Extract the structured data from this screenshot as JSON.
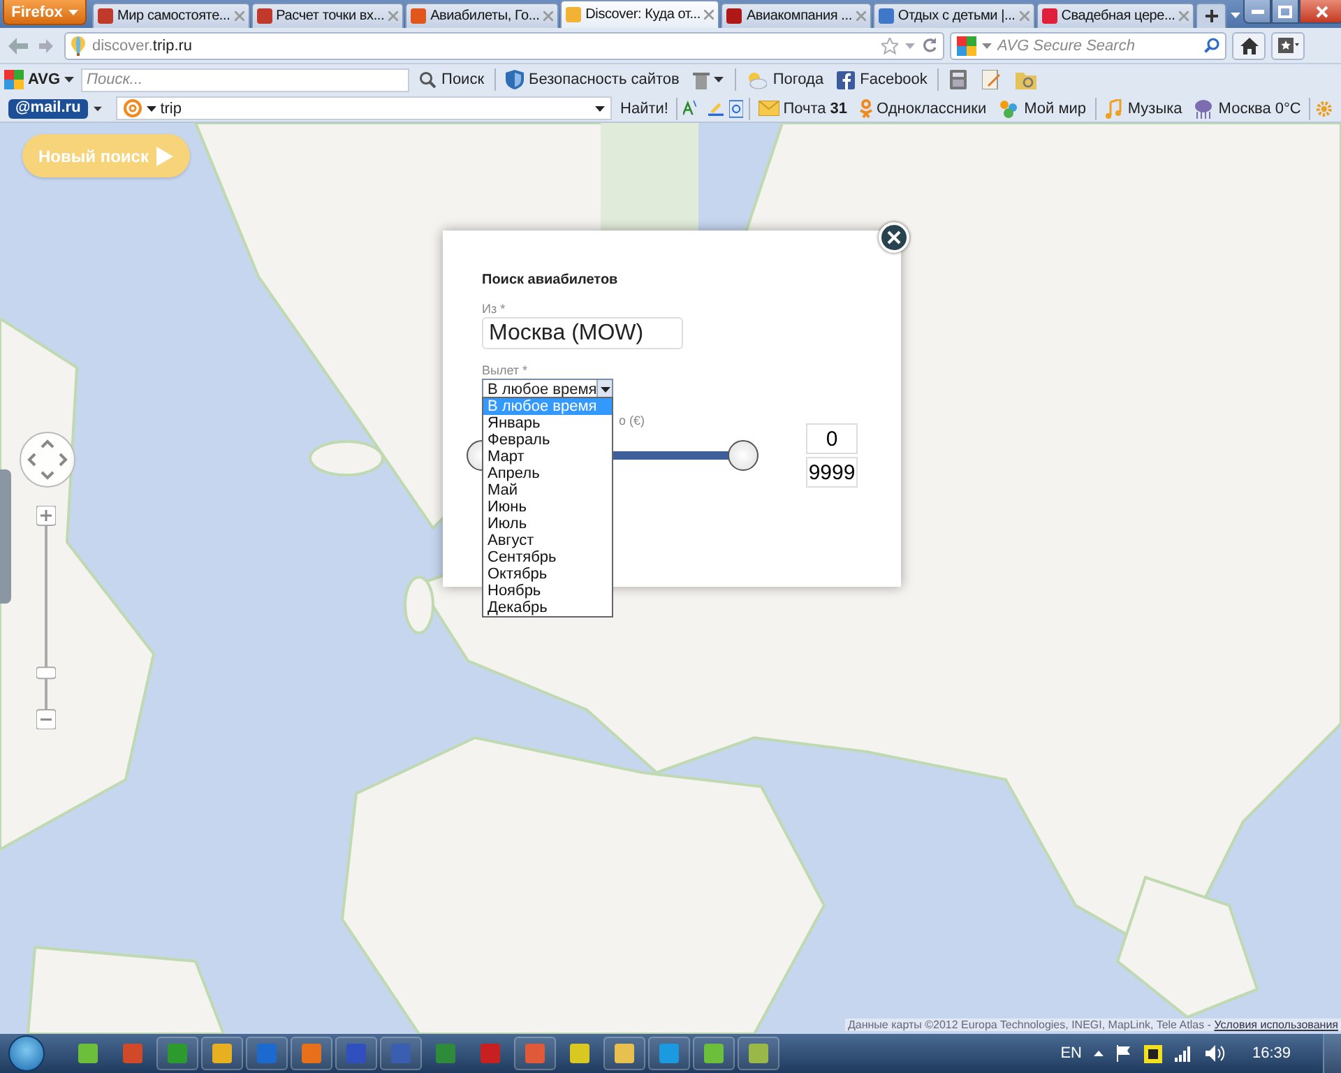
{
  "browser": {
    "menu_button": "Firefox",
    "tabs": [
      {
        "title": "Мир самостояте...",
        "selected": false,
        "color": "#c0392b"
      },
      {
        "title": "Расчет точки вх...",
        "selected": false,
        "color": "#c0392b"
      },
      {
        "title": "Авиабилеты, Го...",
        "selected": false,
        "color": "#e0561b"
      },
      {
        "title": "Discover: Куда от...",
        "selected": true,
        "color": "#f2b233"
      },
      {
        "title": "Авиакомпания ...",
        "selected": false,
        "color": "#b01818"
      },
      {
        "title": "Отдых с детьми |...",
        "selected": false,
        "color": "#3f78c8"
      },
      {
        "title": "Свадебная цере...",
        "selected": false,
        "color": "#e0203a"
      }
    ],
    "address": {
      "subdomain": "discover.",
      "domain": "trip.ru"
    },
    "search_placeholder": "AVG Secure Search"
  },
  "avg_toolbar": {
    "logo": "AVG",
    "search_placeholder": "Поиск...",
    "search_button": "Поиск",
    "items": [
      {
        "kind": "shield",
        "label": "Безопасность сайтов"
      },
      {
        "kind": "trash"
      },
      {
        "kind": "weather",
        "label": "Погода"
      },
      {
        "kind": "facebook",
        "label": "Facebook"
      },
      {
        "kind": "calculator"
      },
      {
        "kind": "notepad"
      },
      {
        "kind": "folder"
      }
    ]
  },
  "mail_toolbar": {
    "logo": "@mail.ru",
    "query": "trip",
    "find_button": "Найти!",
    "items": [
      {
        "kind": "mail",
        "label": "Почта",
        "badge": "31"
      },
      {
        "kind": "ok",
        "label": "Одноклассники"
      },
      {
        "kind": "people",
        "label": "Мой мир"
      },
      {
        "kind": "music",
        "label": "Музыка"
      },
      {
        "kind": "weather",
        "label": "Москва 0°C"
      }
    ]
  },
  "map": {
    "new_search_button": "Новый поиск",
    "zoom": {
      "level": 0.2
    },
    "attribution": "Данные карты ©2012 Europa Technologies, INEGI, MapLink, Tele Atlas -",
    "terms_link": "Условия использования"
  },
  "dialog": {
    "title": "Поиск авиабилетов",
    "from": {
      "label": "Из *",
      "value": "Москва (MOW)"
    },
    "departure": {
      "label": "Вылет *",
      "value": "В любое время",
      "expanded": true,
      "options": [
        {
          "label": "В любое время",
          "selected": true
        },
        {
          "label": "Январь",
          "selected": false
        },
        {
          "label": "Февраль",
          "selected": false
        },
        {
          "label": "Март",
          "selected": false
        },
        {
          "label": "Апрель",
          "selected": false
        },
        {
          "label": "Май",
          "selected": false
        },
        {
          "label": "Июнь",
          "selected": false
        },
        {
          "label": "Июль",
          "selected": false
        },
        {
          "label": "Август",
          "selected": false
        },
        {
          "label": "Сентябрь",
          "selected": false
        },
        {
          "label": "Октябрь",
          "selected": false
        },
        {
          "label": "Ноябрь",
          "selected": false
        },
        {
          "label": "Декабрь",
          "selected": false
        }
      ]
    },
    "price": {
      "label": "о (€)",
      "level": 1,
      "min": "0",
      "max": "9999"
    }
  },
  "taskbar": {
    "language": "EN",
    "clock": "16:39"
  }
}
